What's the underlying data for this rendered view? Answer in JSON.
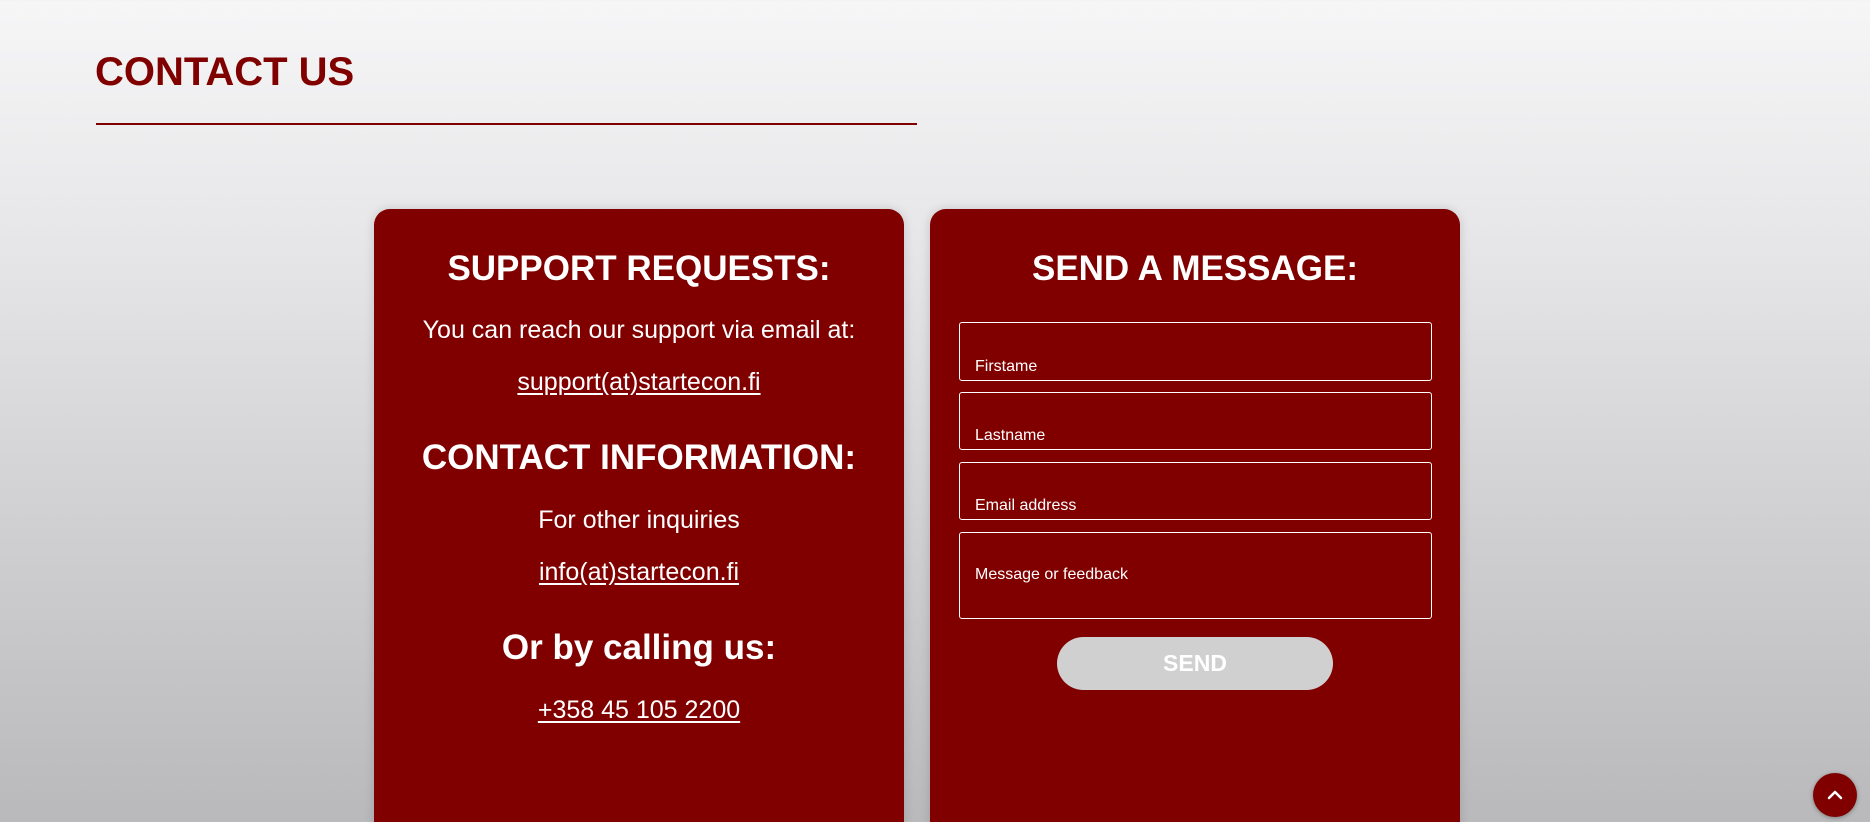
{
  "page": {
    "title": "CONTACT US"
  },
  "support_card": {
    "support_heading": "SUPPORT REQUESTS:",
    "support_text": "You can reach our support via email at:",
    "support_email": "support(at)startecon.fi",
    "contact_heading": "CONTACT INFORMATION:",
    "contact_text": "For other inquiries",
    "contact_email": "info(at)startecon.fi",
    "phone_heading": "Or by calling us:",
    "phone_number": "+358 45 105 2200"
  },
  "message_form": {
    "heading": "SEND A MESSAGE:",
    "firstname_placeholder": "Firstame",
    "lastname_placeholder": "Lastname",
    "email_placeholder": "Email address",
    "message_placeholder": "Message or feedback",
    "send_label": "SEND"
  },
  "colors": {
    "brand": "#800000",
    "button_disabled": "#d0d0d0",
    "text_on_brand": "#ffffff"
  },
  "icons": {
    "scroll_top": "chevron-up-icon"
  }
}
